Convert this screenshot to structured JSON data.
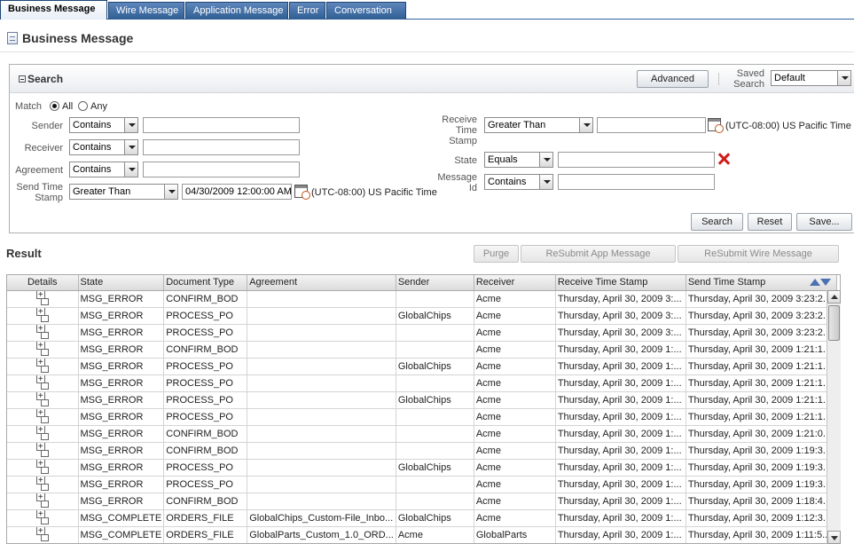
{
  "tabs": [
    {
      "label": "Business Message"
    },
    {
      "label": "Wire Message"
    },
    {
      "label": "Application Message"
    },
    {
      "label": "Error"
    },
    {
      "label": "Conversation"
    }
  ],
  "page": {
    "title": "Business Message"
  },
  "search": {
    "title": "Search",
    "advanced_label": "Advanced",
    "saved_search_label": "Saved Search",
    "saved_search_value": "Default",
    "match_label": "Match",
    "match_all": "All",
    "match_any": "Any",
    "sender_label": "Sender",
    "sender_op": "Contains",
    "receiver_label": "Receiver",
    "receiver_op": "Contains",
    "agreement_label": "Agreement",
    "agreement_op": "Contains",
    "send_ts_label": "Send Time Stamp",
    "send_ts_op": "Greater Than",
    "send_ts_value": "04/30/2009 12:00:00 AM",
    "send_ts_tz": "(UTC-08:00) US Pacific Time",
    "receive_ts_label": "Receive Time Stamp",
    "receive_ts_op": "Greater Than",
    "receive_ts_tz": "(UTC-08:00) US Pacific Time",
    "state_label": "State",
    "state_op": "Equals",
    "message_id_label": "Message Id",
    "message_id_op": "Contains",
    "search_btn": "Search",
    "reset_btn": "Reset",
    "save_btn": "Save..."
  },
  "result": {
    "title": "Result",
    "purge_btn": "Purge",
    "resubmit_app_btn": "ReSubmit App Message",
    "resubmit_wire_btn": "ReSubmit Wire Message",
    "columns": [
      "Details",
      "State",
      "Document Type",
      "Agreement",
      "Sender",
      "Receiver",
      "Receive Time Stamp",
      "Send Time Stamp"
    ],
    "rows": [
      {
        "state": "MSG_ERROR",
        "doctype": "CONFIRM_BOD",
        "agreement": "",
        "sender": "",
        "receiver": "Acme",
        "recv": "Thursday, April 30, 2009 3:...",
        "send": "Thursday, April 30, 2009 3:23:2..."
      },
      {
        "state": "MSG_ERROR",
        "doctype": "PROCESS_PO",
        "agreement": "",
        "sender": "GlobalChips",
        "receiver": "Acme",
        "recv": "Thursday, April 30, 2009 3:...",
        "send": "Thursday, April 30, 2009 3:23:2..."
      },
      {
        "state": "MSG_ERROR",
        "doctype": "PROCESS_PO",
        "agreement": "",
        "sender": "",
        "receiver": "Acme",
        "recv": "Thursday, April 30, 2009 3:...",
        "send": "Thursday, April 30, 2009 3:23:2..."
      },
      {
        "state": "MSG_ERROR",
        "doctype": "CONFIRM_BOD",
        "agreement": "",
        "sender": "",
        "receiver": "Acme",
        "recv": "Thursday, April 30, 2009 1:...",
        "send": "Thursday, April 30, 2009 1:21:1..."
      },
      {
        "state": "MSG_ERROR",
        "doctype": "PROCESS_PO",
        "agreement": "",
        "sender": "GlobalChips",
        "receiver": "Acme",
        "recv": "Thursday, April 30, 2009 1:...",
        "send": "Thursday, April 30, 2009 1:21:1..."
      },
      {
        "state": "MSG_ERROR",
        "doctype": "PROCESS_PO",
        "agreement": "",
        "sender": "",
        "receiver": "Acme",
        "recv": "Thursday, April 30, 2009 1:...",
        "send": "Thursday, April 30, 2009 1:21:1..."
      },
      {
        "state": "MSG_ERROR",
        "doctype": "PROCESS_PO",
        "agreement": "",
        "sender": "GlobalChips",
        "receiver": "Acme",
        "recv": "Thursday, April 30, 2009 1:...",
        "send": "Thursday, April 30, 2009 1:21:1..."
      },
      {
        "state": "MSG_ERROR",
        "doctype": "PROCESS_PO",
        "agreement": "",
        "sender": "",
        "receiver": "Acme",
        "recv": "Thursday, April 30, 2009 1:...",
        "send": "Thursday, April 30, 2009 1:21:1..."
      },
      {
        "state": "MSG_ERROR",
        "doctype": "CONFIRM_BOD",
        "agreement": "",
        "sender": "",
        "receiver": "Acme",
        "recv": "Thursday, April 30, 2009 1:...",
        "send": "Thursday, April 30, 2009 1:21:0..."
      },
      {
        "state": "MSG_ERROR",
        "doctype": "CONFIRM_BOD",
        "agreement": "",
        "sender": "",
        "receiver": "Acme",
        "recv": "Thursday, April 30, 2009 1:...",
        "send": "Thursday, April 30, 2009 1:19:3..."
      },
      {
        "state": "MSG_ERROR",
        "doctype": "PROCESS_PO",
        "agreement": "",
        "sender": "GlobalChips",
        "receiver": "Acme",
        "recv": "Thursday, April 30, 2009 1:...",
        "send": "Thursday, April 30, 2009 1:19:3..."
      },
      {
        "state": "MSG_ERROR",
        "doctype": "PROCESS_PO",
        "agreement": "",
        "sender": "",
        "receiver": "Acme",
        "recv": "Thursday, April 30, 2009 1:...",
        "send": "Thursday, April 30, 2009 1:19:3..."
      },
      {
        "state": "MSG_ERROR",
        "doctype": "CONFIRM_BOD",
        "agreement": "",
        "sender": "",
        "receiver": "Acme",
        "recv": "Thursday, April 30, 2009 1:...",
        "send": "Thursday, April 30, 2009 1:18:4..."
      },
      {
        "state": "MSG_COMPLETE",
        "doctype": "ORDERS_FILE",
        "agreement": "GlobalChips_Custom-File_Inbo...",
        "sender": "GlobalChips",
        "receiver": "Acme",
        "recv": "Thursday, April 30, 2009 1:...",
        "send": "Thursday, April 30, 2009 1:12:3..."
      },
      {
        "state": "MSG_COMPLETE",
        "doctype": "ORDERS_FILE",
        "agreement": "GlobalParts_Custom_1.0_ORD...",
        "sender": "Acme",
        "receiver": "GlobalParts",
        "recv": "Thursday, April 30, 2009 1:...",
        "send": "Thursday, April 30, 2009 1:11:5..."
      }
    ]
  }
}
